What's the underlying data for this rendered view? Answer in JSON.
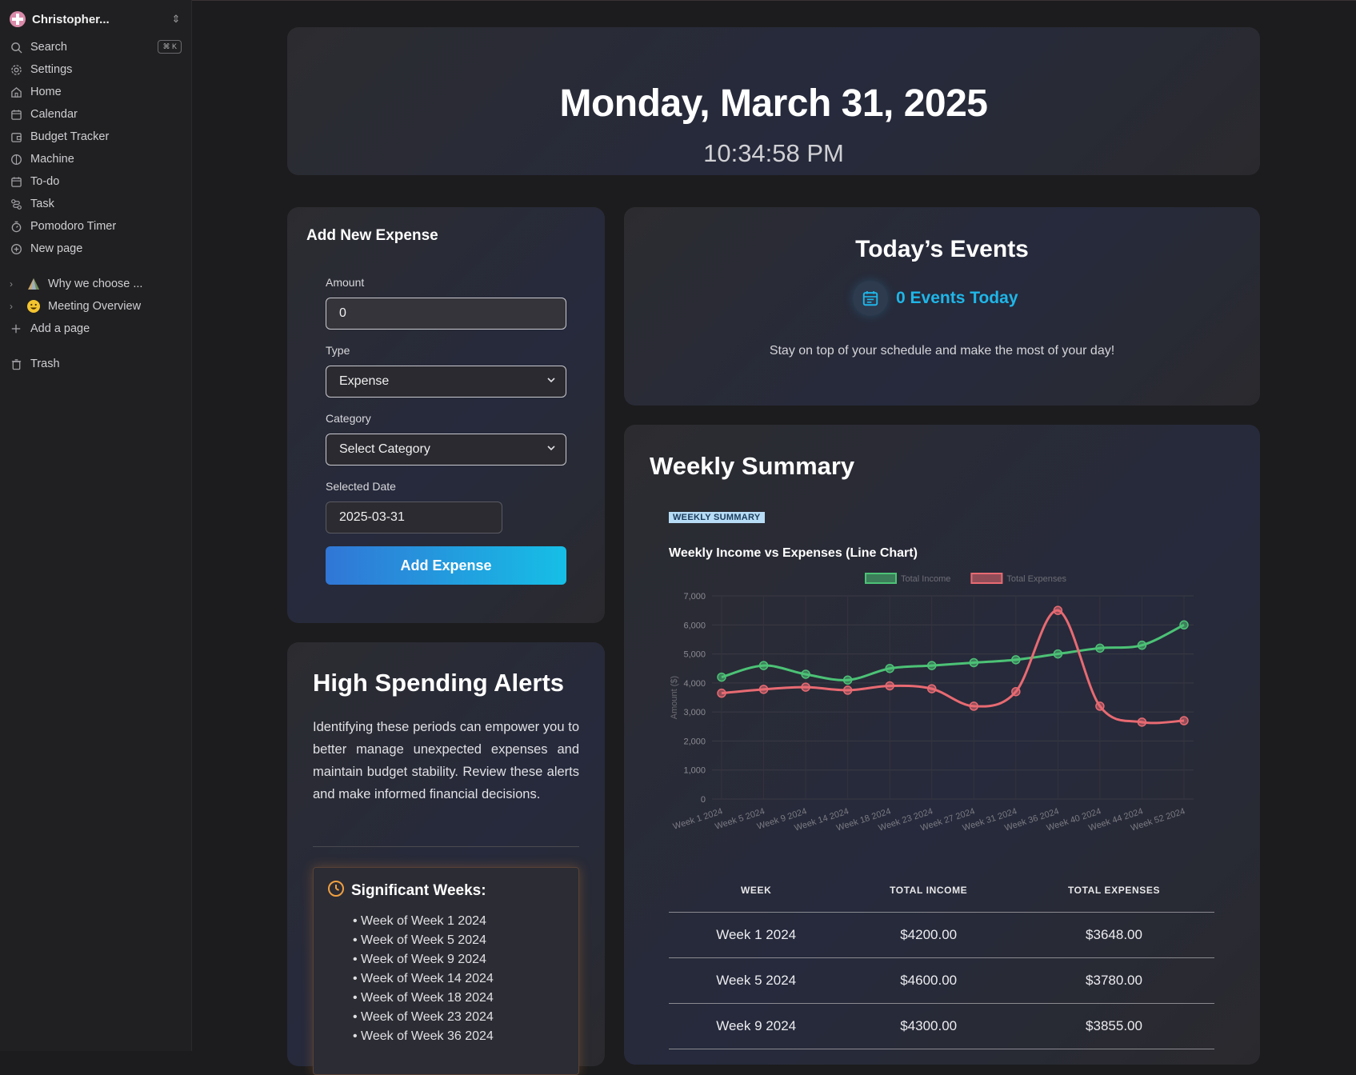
{
  "workspace": {
    "name": "Christopher...",
    "switch_icon": "chevron-updown-icon"
  },
  "sidebar": {
    "search_label": "Search",
    "search_shortcut": "⌘ K",
    "items": [
      {
        "label": "Settings",
        "icon": "gear-icon"
      },
      {
        "label": "Home",
        "icon": "home-icon"
      },
      {
        "label": "Calendar",
        "icon": "calendar-icon"
      },
      {
        "label": "Budget Tracker",
        "icon": "wallet-icon"
      },
      {
        "label": "Machine",
        "icon": "brain-icon"
      },
      {
        "label": "To-do",
        "icon": "calendar-icon"
      },
      {
        "label": "Task",
        "icon": "route-icon"
      },
      {
        "label": "Pomodoro Timer",
        "icon": "timer-icon"
      },
      {
        "label": "New page",
        "icon": "plus-circle-icon"
      }
    ],
    "pages": [
      {
        "label": "Why we choose ...",
        "icon": "pyramid-emoji-icon"
      },
      {
        "label": "Meeting Overview",
        "icon": "smiley-emoji-icon"
      }
    ],
    "add_page_label": "Add a page",
    "trash_label": "Trash"
  },
  "header": {
    "date": "Monday, March 31, 2025",
    "time": "10:34:58 PM"
  },
  "expense_form": {
    "title": "Add New Expense",
    "amount_label": "Amount",
    "amount_value": "0",
    "type_label": "Type",
    "type_value": "Expense",
    "category_label": "Category",
    "category_value": "Select Category",
    "date_label": "Selected Date",
    "date_value": "2025-03-31",
    "submit_label": "Add Expense"
  },
  "events": {
    "title": "Today’s Events",
    "count_label": "0 Events Today",
    "subtitle": "Stay on top of your schedule and make the most of your day!"
  },
  "alerts": {
    "title": "High Spending Alerts",
    "description": "Identifying these periods can empower you to better manage unexpected expenses and maintain budget stability. Review these alerts and make informed financial decisions.",
    "significant_title": "Significant Weeks:",
    "weeks": [
      "Week of Week 1 2024",
      "Week of Week 5 2024",
      "Week of Week 9 2024",
      "Week of Week 14 2024",
      "Week of Week 18 2024",
      "Week of Week 23 2024",
      "Week of Week 36 2024"
    ]
  },
  "summary": {
    "title": "Weekly Summary",
    "badge": "WEEKLY SUMMARY",
    "chart_title": "Weekly Income vs Expenses (Line Chart)",
    "table": {
      "headers": [
        "WEEK",
        "TOTAL INCOME",
        "TOTAL EXPENSES"
      ],
      "rows": [
        [
          "Week 1 2024",
          "$4200.00",
          "$3648.00"
        ],
        [
          "Week 5 2024",
          "$4600.00",
          "$3780.00"
        ],
        [
          "Week 9 2024",
          "$4300.00",
          "$3855.00"
        ]
      ]
    }
  },
  "chart_data": {
    "type": "line",
    "categories": [
      "Week 1 2024",
      "Week 5 2024",
      "Week 9 2024",
      "Week 14 2024",
      "Week 18 2024",
      "Week 23 2024",
      "Week 27 2024",
      "Week 31 2024",
      "Week 36 2024",
      "Week 40 2024",
      "Week 44 2024",
      "Week 52 2024"
    ],
    "series": [
      {
        "name": "Total Income",
        "color": "#4cc276",
        "values": [
          4200,
          4600,
          4300,
          4100,
          4500,
          4600,
          4700,
          4800,
          5000,
          5200,
          5300,
          6000
        ]
      },
      {
        "name": "Total Expenses",
        "color": "#e86a72",
        "values": [
          3648,
          3780,
          3855,
          3750,
          3900,
          3800,
          3200,
          3700,
          6500,
          3200,
          2650,
          2700
        ]
      }
    ],
    "ylabel": "Amount ($)",
    "ylim": [
      0,
      7000
    ],
    "yticks": [
      "0",
      "1,000",
      "2,000",
      "3,000",
      "4,000",
      "5,000",
      "6,000",
      "7,000"
    ],
    "grid": true,
    "legend": "top-center"
  },
  "colors": {
    "accent": "#1fb6e8",
    "income": "#4cc276",
    "expense": "#e86a72",
    "alert": "#f0a040"
  }
}
